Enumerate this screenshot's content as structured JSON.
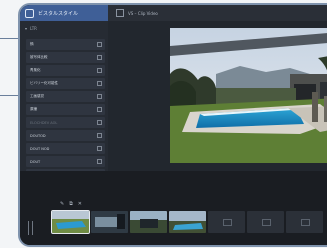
{
  "panel": {
    "title": "ビスタルスタイル",
    "subtitle": "LTR",
    "items": [
      {
        "label": "鍋"
      },
      {
        "label": "被写体比較"
      },
      {
        "label": "青風化"
      },
      {
        "label": "ビバリー化可能性"
      },
      {
        "label": "工画感覚"
      },
      {
        "label": "原鐘"
      },
      {
        "label": "ELOCHDEV AOL",
        "dim": true
      },
      {
        "label": "DOUTOD"
      },
      {
        "label": "DOUT NOD"
      },
      {
        "label": "DOUT"
      },
      {
        "label": "TOTOEOY"
      }
    ]
  },
  "viewer": {
    "title": "VS – Clip Video"
  },
  "timeline": {
    "clips": [
      "photo",
      "photo",
      "photo",
      "photo",
      "empty",
      "empty",
      "empty"
    ]
  }
}
